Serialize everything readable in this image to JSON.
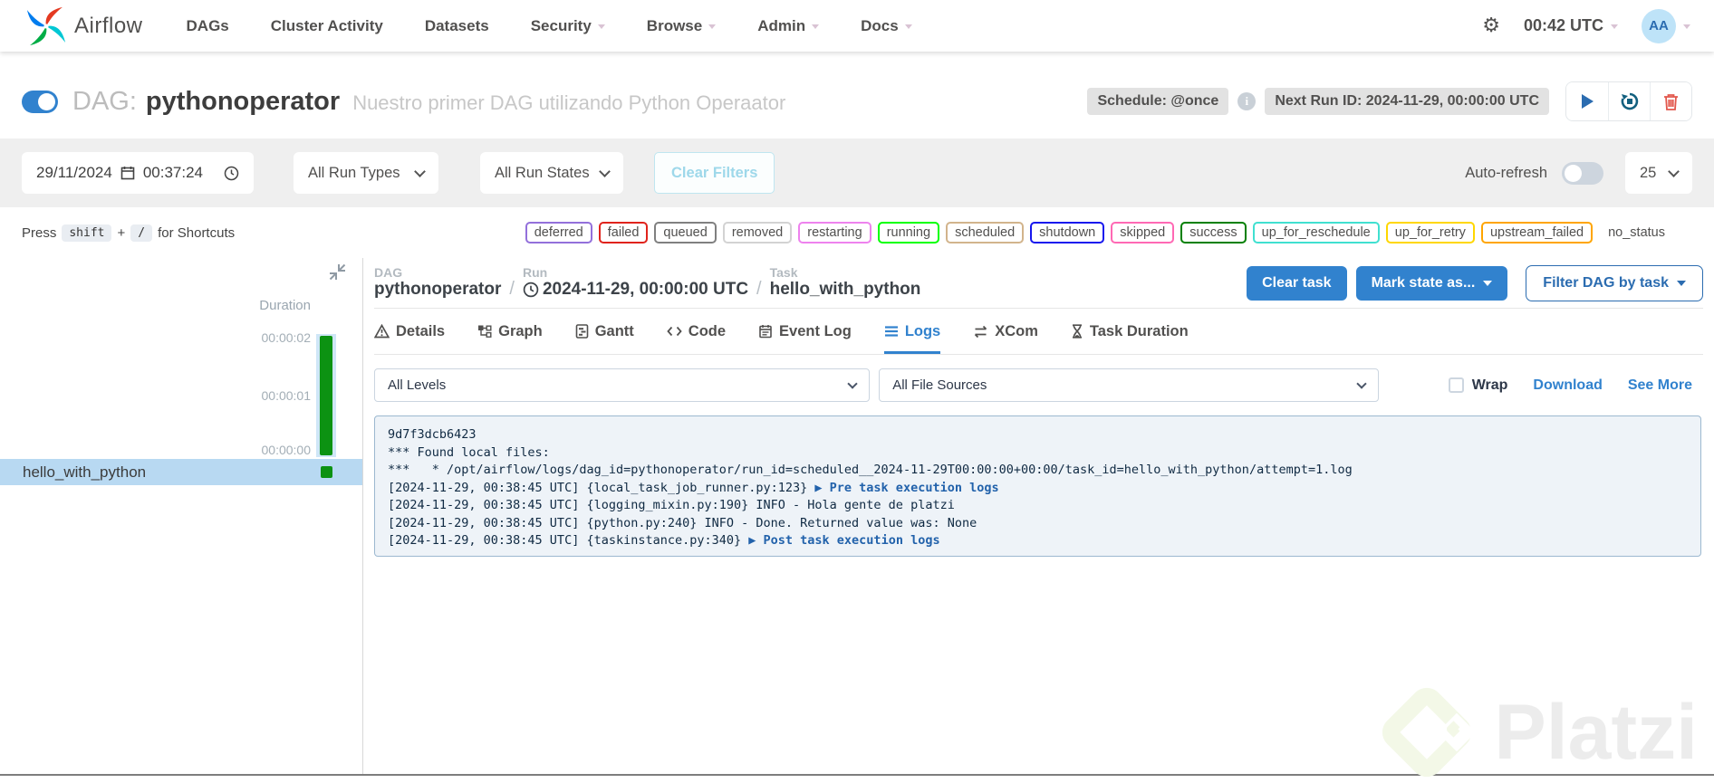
{
  "navbar": {
    "brand": "Airflow",
    "items": [
      {
        "label": "DAGs",
        "caret": false
      },
      {
        "label": "Cluster Activity",
        "caret": false
      },
      {
        "label": "Datasets",
        "caret": false
      },
      {
        "label": "Security",
        "caret": true
      },
      {
        "label": "Browse",
        "caret": true
      },
      {
        "label": "Admin",
        "caret": true
      },
      {
        "label": "Docs",
        "caret": true
      }
    ],
    "time": "00:42 UTC",
    "avatar_initials": "AA"
  },
  "dag_header": {
    "dag_label": "DAG:",
    "dag_name": "pythonoperator",
    "description": "Nuestro primer DAG utilizando Python Operaator",
    "schedule_badge": "Schedule: @once",
    "next_run_badge": "Next Run ID: 2024-11-29, 00:00:00 UTC",
    "info_glyph": "i"
  },
  "filters": {
    "date_value": "29/11/2024",
    "time_value": "00:37:24",
    "run_types": "All Run Types",
    "run_states": "All Run States",
    "clear_filters": "Clear Filters",
    "auto_refresh_label": "Auto-refresh",
    "page_size": "25"
  },
  "shortcuts": {
    "press": "Press",
    "key1": "shift",
    "plus": "+",
    "key2": "/",
    "suffix": "for Shortcuts"
  },
  "status_badges": [
    {
      "label": "deferred",
      "color": "#9370DB"
    },
    {
      "label": "failed",
      "color": "#e0231c"
    },
    {
      "label": "queued",
      "color": "#808080"
    },
    {
      "label": "removed",
      "color": "#D3D3D3"
    },
    {
      "label": "restarting",
      "color": "#EE82EE"
    },
    {
      "label": "running",
      "color": "#00FF00"
    },
    {
      "label": "scheduled",
      "color": "#D2B48C"
    },
    {
      "label": "shutdown",
      "color": "#1717ee"
    },
    {
      "label": "skipped",
      "color": "#FF69B4"
    },
    {
      "label": "success",
      "color": "#008000"
    },
    {
      "label": "up_for_reschedule",
      "color": "#40E0D0"
    },
    {
      "label": "up_for_retry",
      "color": "#FFD700"
    },
    {
      "label": "upstream_failed",
      "color": "#FFA500"
    },
    {
      "label": "no_status",
      "color": "transparent"
    }
  ],
  "sidebar": {
    "duration_label": "Duration",
    "ticks": [
      "00:00:02",
      "00:00:01",
      "00:00:00"
    ],
    "task_name": "hello_with_python",
    "bar_color": "#0c9212"
  },
  "breadcrumb": {
    "dag_label": "DAG",
    "dag_value": "pythonoperator",
    "run_label": "Run",
    "run_value": "2024-11-29, 00:00:00 UTC",
    "task_label": "Task",
    "task_value": "hello_with_python",
    "separator": "/"
  },
  "actions": {
    "clear_task": "Clear task",
    "mark_state": "Mark state as...",
    "filter_dag": "Filter DAG by task"
  },
  "tabs": [
    {
      "label": "Details"
    },
    {
      "label": "Graph"
    },
    {
      "label": "Gantt"
    },
    {
      "label": "Code"
    },
    {
      "label": "Event Log"
    },
    {
      "label": "Logs"
    },
    {
      "label": "XCom"
    },
    {
      "label": "Task Duration"
    }
  ],
  "log_controls": {
    "levels": "All Levels",
    "sources": "All File Sources",
    "wrap": "Wrap",
    "download": "Download",
    "see_more": "See More"
  },
  "logs": {
    "lines": [
      {
        "text": "9d7f3dcb6423",
        "link": null
      },
      {
        "text": "*** Found local files:",
        "link": null
      },
      {
        "text": "***   * /opt/airflow/logs/dag_id=pythonoperator/run_id=scheduled__2024-11-29T00:00:00+00:00/task_id=hello_with_python/attempt=1.log",
        "link": null
      },
      {
        "text": "[2024-11-29, 00:38:45 UTC] {local_task_job_runner.py:123} ",
        "link": "▶ Pre task execution logs"
      },
      {
        "text": "[2024-11-29, 00:38:45 UTC] {logging_mixin.py:190} INFO - Hola gente de platzi",
        "link": null
      },
      {
        "text": "[2024-11-29, 00:38:45 UTC] {python.py:240} INFO - Done. Returned value was: None",
        "link": null
      },
      {
        "text": "[2024-11-29, 00:38:45 UTC] {taskinstance.py:340} ",
        "link": "▶ Post task execution logs"
      }
    ]
  },
  "watermark": {
    "text": "Platzi"
  }
}
